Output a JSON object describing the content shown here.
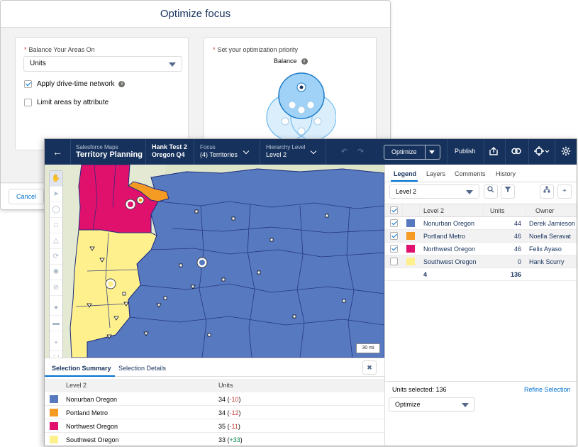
{
  "modal": {
    "title": "Optimize focus",
    "balance_label": "Balance Your Areas On",
    "balance_value": "Units",
    "apply_network_label": "Apply drive-time network",
    "limit_areas_label": "Limit areas by attribute",
    "priority_label": "Set your optimization priority",
    "venn_label": "Balance",
    "cancel_label": "Cancel",
    "apply_network_checked": true,
    "limit_areas_checked": false
  },
  "topbar": {
    "app_small": "Salesforce Maps",
    "app_title": "Territory Planning",
    "plan_line1": "Hank Test 2",
    "plan_line2": "Oregon Q4",
    "focus_label": "Focus",
    "focus_value": "(4) Territories",
    "hierarchy_label": "Hierarchy Level",
    "hierarchy_value": "Level 2",
    "optimize_label": "Optimize",
    "publish_label": "Publish",
    "bg_color": "#16325c"
  },
  "map": {
    "scale_label": "30 mi",
    "tool_icons": [
      "hand-icon",
      "pointer-icon",
      "circle-select-icon",
      "rectangle-select-icon",
      "polygon-select-icon",
      "lasso-icon",
      "gear-icon",
      "block-icon",
      "merge-icon",
      "split-icon",
      "zoom-in-icon",
      "fullscreen-icon"
    ]
  },
  "summary": {
    "tabs": [
      "Selection Summary",
      "Selection Details"
    ],
    "columns": [
      "Level 2",
      "Units"
    ],
    "rows": [
      {
        "name": "Nonurban Oregon",
        "units": "34",
        "delta": "-10",
        "color": "#5679c0"
      },
      {
        "name": "Portland Metro",
        "units": "34",
        "delta": "-12",
        "color": "#f59a23"
      },
      {
        "name": "Northwest Oregon",
        "units": "35",
        "delta": "-11",
        "color": "#e0116d"
      },
      {
        "name": "Southwest Oregon",
        "units": "33",
        "delta": "+33",
        "color": "#fdf08d"
      }
    ]
  },
  "legend": {
    "tabs": [
      "Legend",
      "Layers",
      "Comments",
      "History"
    ],
    "level_select": "Level 2",
    "columns": [
      "Level 2",
      "Units",
      "Owner"
    ],
    "rows": [
      {
        "name": "Nonurban Oregon",
        "units": "44",
        "owner": "Derek Jamieson",
        "color": "#5679c0",
        "checked": true
      },
      {
        "name": "Portland Metro",
        "units": "46",
        "owner": "Noella Seravat",
        "color": "#f59a23",
        "checked": true
      },
      {
        "name": "Northwest Oregon",
        "units": "46",
        "owner": "Felix Ayaso",
        "color": "#e0116d",
        "checked": true
      },
      {
        "name": "Southwest Oregon",
        "units": "0",
        "owner": "Hank Scurry",
        "color": "#fdf08d",
        "checked": false
      }
    ],
    "total_count": "4",
    "total_units": "136",
    "units_selected": "Units selected: 136",
    "refine_label": "Refine Selection",
    "optimize_select": "Optimize"
  }
}
